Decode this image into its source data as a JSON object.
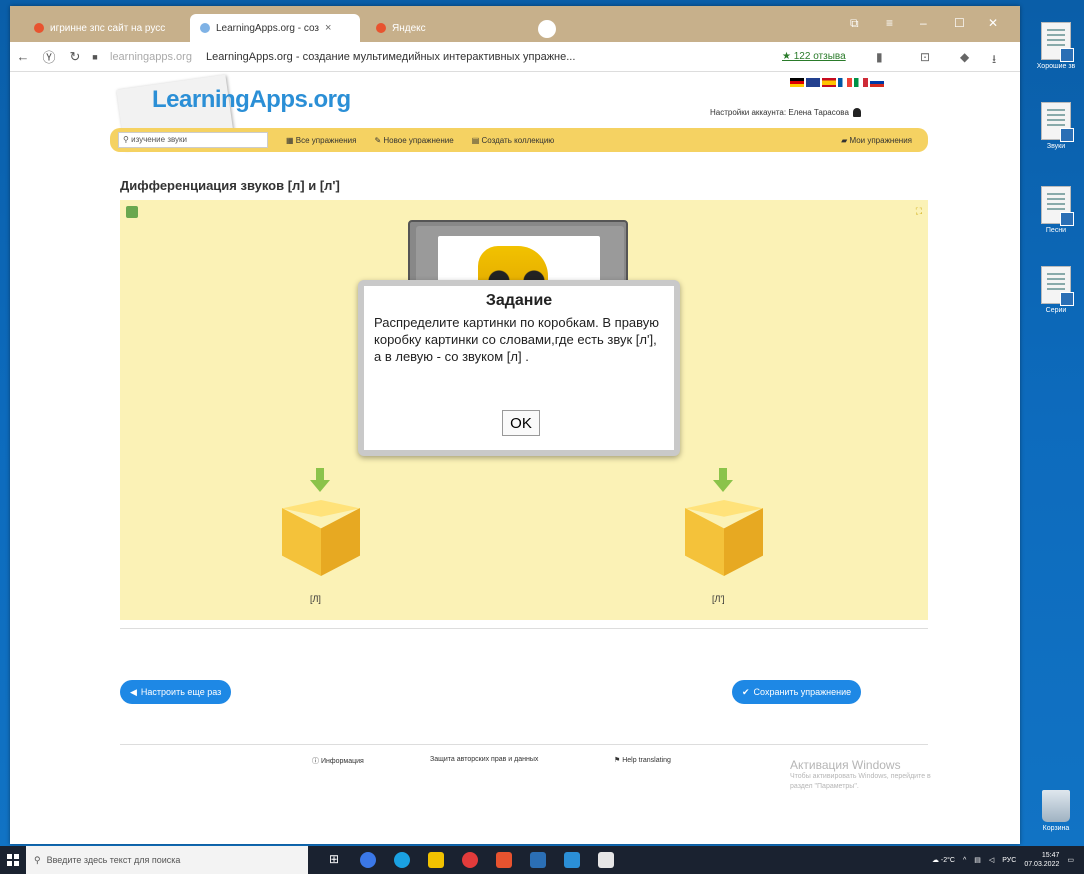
{
  "browser": {
    "tabs": [
      {
        "label": "игриннe зпс сайт на русс"
      },
      {
        "label": "LearningApps.org - соз"
      },
      {
        "label": "Яндекс"
      }
    ],
    "url_host": "learningapps.org",
    "url_title": "LearningApps.org - создание мультимедийных интерактивных упражне...",
    "reviews": "★ 122 отзыва"
  },
  "site": {
    "logo": "LearningApps.org",
    "account_text": "Настройки аккаунта: Елена Тарасова",
    "search_value": "изучение звуки",
    "menu": {
      "all_exercises": "Все упражнения",
      "new_exercise": "Новое упражнение",
      "create_collection": "Создать коллекцию",
      "my_exercises": "Мои упражнения"
    },
    "exercise_title": "Дифференциация звуков [л] и [л']"
  },
  "game": {
    "modal": {
      "title": "Задание",
      "text": "Распределите картинки по коробкам. В правую коробку картинки со словами,где есть звук [л'], а в левую - со звуком [л] .",
      "ok": "OK"
    },
    "left_box_label": "[Л]",
    "right_box_label": "[Л']"
  },
  "actions": {
    "configure_again": "Настроить еще раз",
    "save_exercise": "Сохранить упражнение"
  },
  "footer": {
    "info": "Информация",
    "privacy": "Защита авторских прав и данных",
    "help": "Help translating"
  },
  "watermark": {
    "line1": "Активация Windows",
    "line2": "Чтобы активировать Windows, перейдите в",
    "line3": "раздел \"Параметры\"."
  },
  "desktop": {
    "icons": [
      "Хорошие зв",
      "Звуки",
      "Песни",
      "Серии"
    ],
    "recycle": "Корзина"
  },
  "taskbar": {
    "search_placeholder": "Введите здесь текст для поиска",
    "weather": "-2°C",
    "lang": "РУС",
    "time": "15:47",
    "date": "07.03.2022"
  },
  "colors": {
    "accent": "#1e88e5",
    "menubar": "#f5d262",
    "game_bg": "#fbf2b6",
    "tab_bar": "#c7b08b"
  }
}
